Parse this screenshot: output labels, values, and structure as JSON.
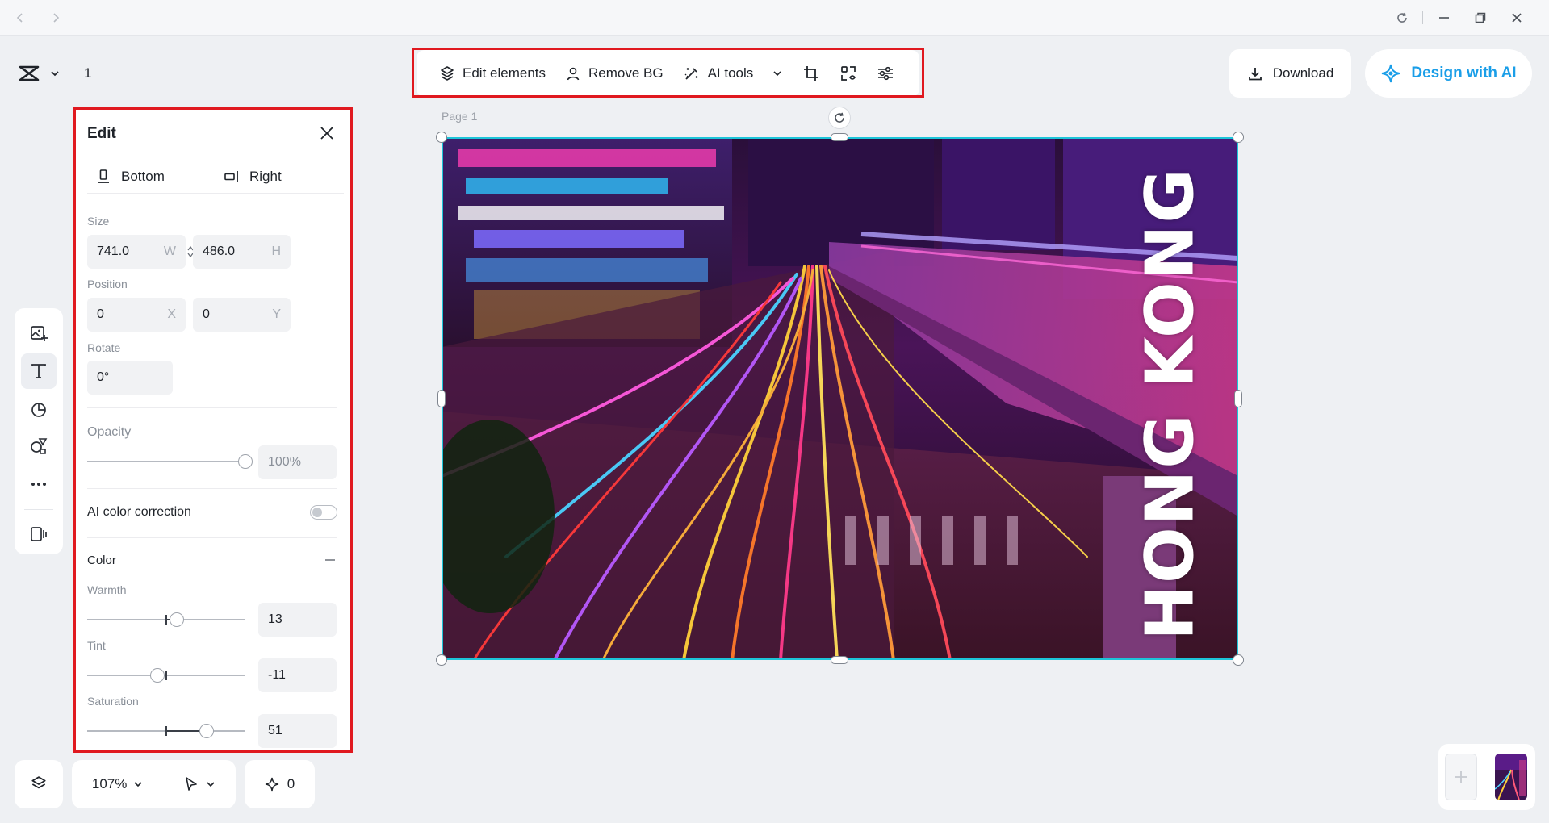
{
  "window": {
    "back_icon": "chevron-left-icon",
    "forward_icon": "chevron-right-icon",
    "refresh_icon": "refresh-icon",
    "minimize_icon": "minimize-icon",
    "restore_icon": "restore-icon",
    "close_icon": "close-icon"
  },
  "project": {
    "page_count": "1"
  },
  "toolbar": {
    "edit_elements": "Edit elements",
    "remove_bg": "Remove BG",
    "ai_tools": "AI tools"
  },
  "header": {
    "download": "Download",
    "design_with_ai": "Design with AI",
    "accent_color": "#1a9ee8"
  },
  "edit_panel": {
    "title": "Edit",
    "align": {
      "bottom": "Bottom",
      "right": "Right"
    },
    "size": {
      "label": "Size",
      "width": "741.0",
      "width_suffix": "W",
      "height": "486.0",
      "height_suffix": "H"
    },
    "position": {
      "label": "Position",
      "x": "0",
      "x_suffix": "X",
      "y": "0",
      "y_suffix": "Y"
    },
    "rotate": {
      "label": "Rotate",
      "value": "0°"
    },
    "opacity": {
      "label": "Opacity",
      "value": "100%",
      "level": 1.0
    },
    "ai_color_correction": {
      "label": "AI color correction",
      "enabled": false
    },
    "color": {
      "label": "Color",
      "collapse_icon": "minus-icon",
      "warmth": {
        "label": "Warmth",
        "value": "13",
        "level": 13
      },
      "tint": {
        "label": "Tint",
        "value": "-11",
        "level": -11
      },
      "saturation": {
        "label": "Saturation",
        "value": "51",
        "level": 51
      }
    }
  },
  "canvas": {
    "page_label": "Page 1",
    "overlay_text": "HONG KONG",
    "selection_color": "#1cc4d8"
  },
  "bottom_bar": {
    "zoom": "107%",
    "magic_count": "0"
  }
}
